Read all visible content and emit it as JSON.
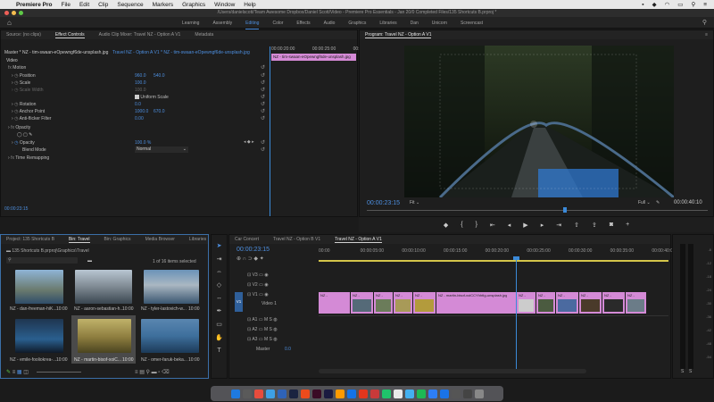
{
  "menubar": {
    "app": "Premiere Pro",
    "items": [
      "File",
      "Edit",
      "Clip",
      "Sequence",
      "Markers",
      "Graphics",
      "Window",
      "Help"
    ],
    "wifi_icon": "wifi-icon",
    "battery_icon": "battery-icon"
  },
  "window_title": "/Users/danielscott/Team Awesome Dropbox/Daniel Scott/Video - Premiere Pro Essentials - Jan 20/0 Completed Files/135 Shortcuts B.prproj *",
  "workspace_tabs": [
    {
      "label": "Learning"
    },
    {
      "label": "Assembly"
    },
    {
      "label": "Editing",
      "active": true
    },
    {
      "label": "Color"
    },
    {
      "label": "Effects"
    },
    {
      "label": "Audio"
    },
    {
      "label": "Graphics"
    },
    {
      "label": "Libraries"
    },
    {
      "label": "Dan"
    },
    {
      "label": "Unicorn"
    },
    {
      "label": "Screencast"
    }
  ],
  "source_panel": {
    "tabs": [
      "Source: (no clips)",
      "Effect Controls",
      "Audio Clip Mixer: Travel NZ - Option A V1",
      "Metadata"
    ],
    "active_tab": "Effect Controls",
    "master_label": "Master * NZ - tim-swaan-eOpewngf6de-unsplash.jpg",
    "sequence_label": "Travel NZ - Option A V1 * NZ - tim-swaan-eOpewngf6de-unsplash.jpg",
    "mini_clip": "NZ - tim-swaan-eOpewngf6de-unsplash.jpg",
    "ruler": [
      "00:00:20:00",
      "00:00:25:00",
      "00:00:30:00"
    ],
    "video_header": "Video",
    "fx_motion": "Motion",
    "position_label": "Position",
    "position_x": "960.0",
    "position_y": "540.0",
    "scale_label": "Scale",
    "scale_value": "100.0",
    "scale_width_label": "Scale Width",
    "scale_width_value": "100.0",
    "uniform_scale": "Uniform Scale",
    "rotation_label": "Rotation",
    "rotation_value": "0.0",
    "anchor_label": "Anchor Point",
    "anchor_x": "1000.0",
    "anchor_y": "670.0",
    "antiflicker_label": "Anti-flicker Filter",
    "antiflicker_value": "0.00",
    "opacity_header": "Opacity",
    "opacity_label": "Opacity",
    "opacity_value": "100.0 %",
    "blend_label": "Blend Mode",
    "blend_value": "Normal",
    "time_remap": "Time Remapping",
    "timecode": "00:00:23:15"
  },
  "program_panel": {
    "title": "Program: Travel NZ - Option A V1",
    "timecode": "00:00:23:15",
    "fit": "Fit",
    "quality": "Full",
    "duration": "00:00:40:10",
    "colors": {
      "highlight": "#2f78d0"
    }
  },
  "project_panel": {
    "tabs": [
      "Project: 135 Shortcuts B",
      "Bin: Travel",
      "Bin: Graphics",
      "Media Browser",
      "Libraries"
    ],
    "active_tab": "Bin: Travel",
    "path": "135 Shortcuts B.prproj\\Graphics\\Travel",
    "selected_count": "1 of 16 items selected",
    "items": [
      {
        "name": "NZ - dan-freeman-hiK...",
        "dur": "10:00"
      },
      {
        "name": "NZ - aaron-sebastian-h...",
        "dur": "10:00"
      },
      {
        "name": "NZ - tyler-lastovich-w...",
        "dur": "10:00"
      },
      {
        "name": "NZ - emile-fooliokrea-...",
        "dur": "10:00"
      },
      {
        "name": "NZ - martin-bisof-xoiC...",
        "dur": "10:00"
      },
      {
        "name": "NZ - omer-faruk-beka...",
        "dur": "10:00"
      }
    ]
  },
  "timeline": {
    "tabs": [
      "Car Concert",
      "Travel NZ - Option B V1",
      "Travel NZ - Option A V1"
    ],
    "active_tab": "Travel NZ - Option A V1",
    "timecode": "00:00:23:15",
    "ruler": [
      "00:00",
      "00:00:05:00",
      "00:00:10:00",
      "00:00:15:00",
      "00:00:20:00",
      "00:00:25:00",
      "00:00:30:00",
      "00:00:35:00",
      "00:00:40:00"
    ],
    "tracks_video": [
      "V3",
      "V2",
      "V1"
    ],
    "track_name_v1": "Video 1",
    "tracks_audio": [
      "A1",
      "A2",
      "A3"
    ],
    "master": "Master",
    "master_value": "0.0",
    "clip_labels": [
      "NZ -",
      "NZ -",
      "NZ -",
      "NZ -",
      "NZ - martin-bisof-xoiCCYhhtIg-unsplash.jpg",
      "NZ -",
      "NZ -",
      "NZ -",
      "NZ -",
      "NZ -"
    ],
    "colors": {
      "clip": "#d48ad6",
      "playhead": "#3b8ad9"
    }
  },
  "audio_meter": {
    "scale": [
      "-6",
      "-12",
      "-18",
      "-24",
      "-30",
      "-36",
      "-42",
      "-48",
      "-54"
    ],
    "footer": [
      "S",
      "S"
    ]
  }
}
